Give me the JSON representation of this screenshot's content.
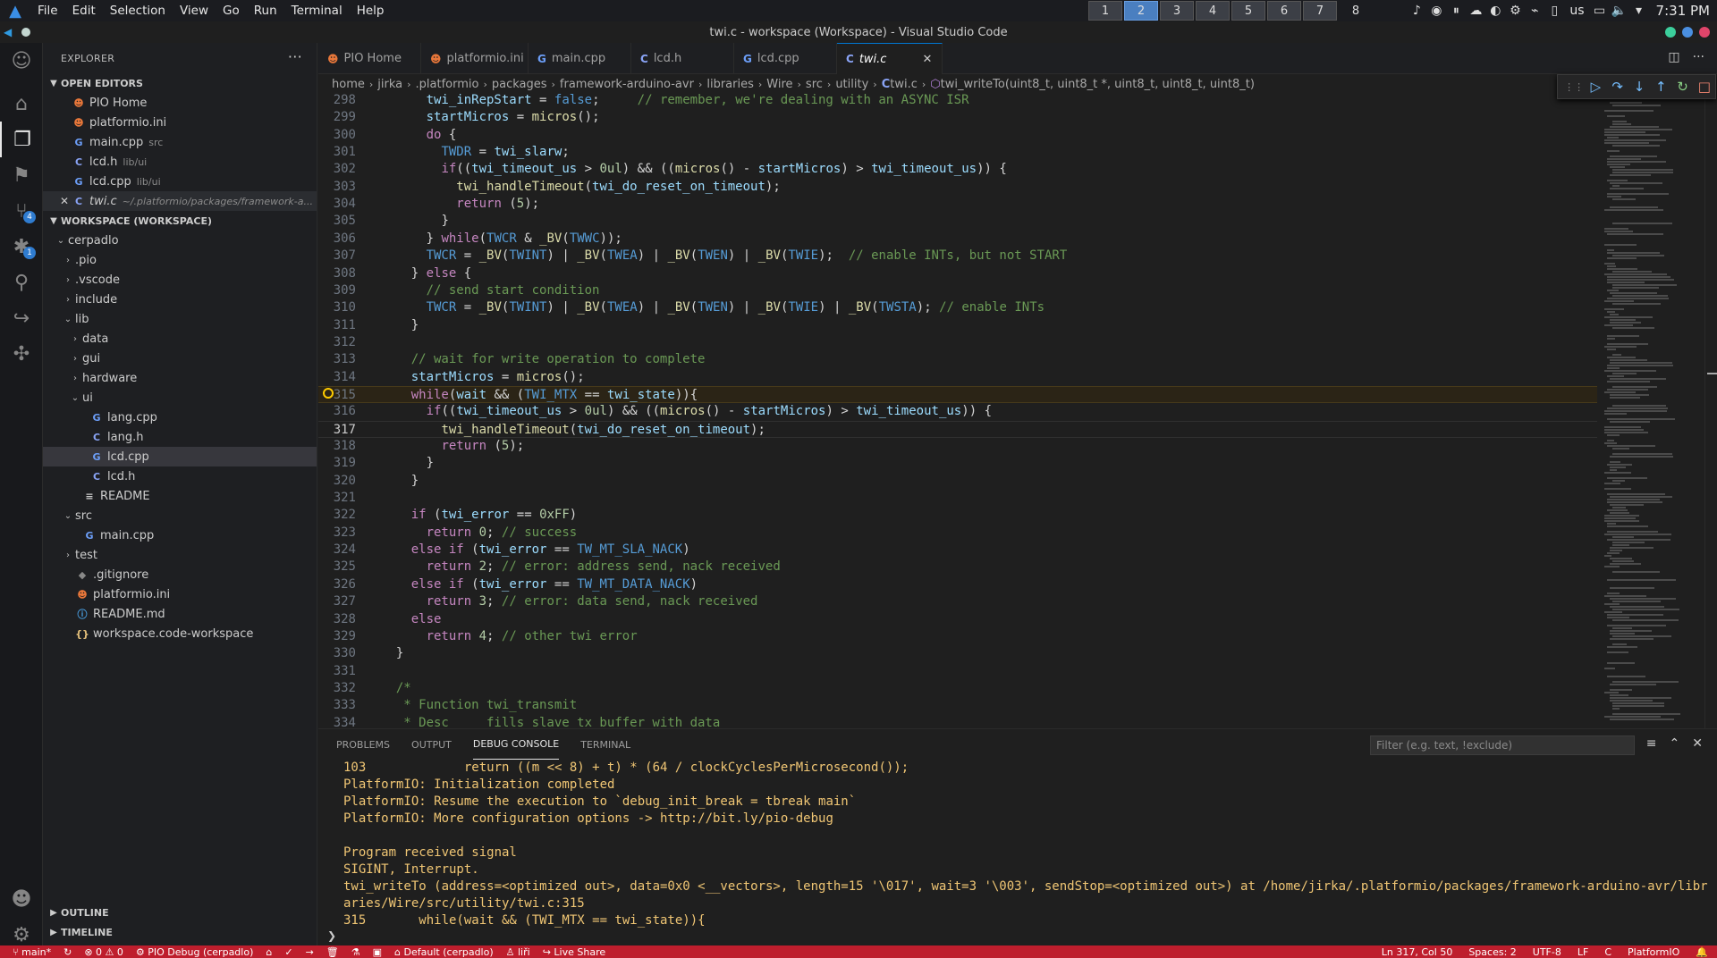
{
  "system_bar": {
    "menu": [
      "File",
      "Edit",
      "Selection",
      "View",
      "Go",
      "Run",
      "Terminal",
      "Help"
    ],
    "workspaces": [
      "1",
      "2",
      "3",
      "4",
      "5",
      "6",
      "7",
      "8"
    ],
    "active_workspace": "2",
    "keyboard_layout": "us",
    "clock": "7:31 PM"
  },
  "window": {
    "title": "twi.c - workspace (Workspace) - Visual Studio Code"
  },
  "activity_bar": {
    "scm_badge": "4",
    "debug_badge": "1"
  },
  "sidebar": {
    "header": "EXPLORER",
    "open_editors_label": "OPEN EDITORS",
    "open_editors": [
      {
        "name": "PIO Home",
        "desc": "",
        "icon": "pio"
      },
      {
        "name": "platformio.ini",
        "desc": "",
        "icon": "pio"
      },
      {
        "name": "main.cpp",
        "desc": "src",
        "icon": "cpp"
      },
      {
        "name": "lcd.h",
        "desc": "lib/ui",
        "icon": "c"
      },
      {
        "name": "lcd.cpp",
        "desc": "lib/ui",
        "icon": "cpp"
      },
      {
        "name": "twi.c",
        "desc": "~/.platformio/packages/framework-a...",
        "icon": "c"
      }
    ],
    "workspace_label": "WORKSPACE (WORKSPACE)",
    "tree": [
      {
        "name": "cerpadlo",
        "depth": 0,
        "type": "folder-open"
      },
      {
        "name": ".pio",
        "depth": 1,
        "type": "folder"
      },
      {
        "name": ".vscode",
        "depth": 1,
        "type": "folder"
      },
      {
        "name": "include",
        "depth": 1,
        "type": "folder"
      },
      {
        "name": "lib",
        "depth": 1,
        "type": "folder-open"
      },
      {
        "name": "data",
        "depth": 2,
        "type": "folder"
      },
      {
        "name": "gui",
        "depth": 2,
        "type": "folder"
      },
      {
        "name": "hardware",
        "depth": 2,
        "type": "folder"
      },
      {
        "name": "ui",
        "depth": 2,
        "type": "folder-open"
      },
      {
        "name": "lang.cpp",
        "depth": 3,
        "type": "cpp"
      },
      {
        "name": "lang.h",
        "depth": 3,
        "type": "c"
      },
      {
        "name": "lcd.cpp",
        "depth": 3,
        "type": "cpp"
      },
      {
        "name": "lcd.h",
        "depth": 3,
        "type": "c"
      },
      {
        "name": "README",
        "depth": 2,
        "type": "text"
      },
      {
        "name": "src",
        "depth": 1,
        "type": "folder-open"
      },
      {
        "name": "main.cpp",
        "depth": 2,
        "type": "cpp"
      },
      {
        "name": "test",
        "depth": 1,
        "type": "folder"
      },
      {
        "name": ".gitignore",
        "depth": 1,
        "type": "git"
      },
      {
        "name": "platformio.ini",
        "depth": 1,
        "type": "pio"
      },
      {
        "name": "README.md",
        "depth": 1,
        "type": "info"
      },
      {
        "name": "workspace.code-workspace",
        "depth": 1,
        "type": "json"
      }
    ],
    "outline_label": "OUTLINE",
    "timeline_label": "TIMELINE"
  },
  "tabs": [
    {
      "label": "PIO Home",
      "icon": "pio"
    },
    {
      "label": "platformio.ini",
      "icon": "pio"
    },
    {
      "label": "main.cpp",
      "icon": "cpp"
    },
    {
      "label": "lcd.h",
      "icon": "c"
    },
    {
      "label": "lcd.cpp",
      "icon": "cpp"
    },
    {
      "label": "twi.c",
      "icon": "c",
      "active": true
    }
  ],
  "breadcrumb": [
    "home",
    "jirka",
    ".platformio",
    "packages",
    "framework-arduino-avr",
    "libraries",
    "Wire",
    "src",
    "utility",
    "twi.c",
    "twi_writeTo(uint8_t, uint8_t *, uint8_t, uint8_t, uint8_t)"
  ],
  "editor": {
    "current_line": 317,
    "breakpoint_line": 315,
    "lines": [
      {
        "n": 298,
        "code": "      twi_inRepStart = false;     // remember, we're dealing with an ASYNC ISR"
      },
      {
        "n": 299,
        "code": "      startMicros = micros();"
      },
      {
        "n": 300,
        "code": "      do {"
      },
      {
        "n": 301,
        "code": "        TWDR = twi_slarw;"
      },
      {
        "n": 302,
        "code": "        if((twi_timeout_us > 0ul) && ((micros() - startMicros) > twi_timeout_us)) {"
      },
      {
        "n": 303,
        "code": "          twi_handleTimeout(twi_do_reset_on_timeout);"
      },
      {
        "n": 304,
        "code": "          return (5);"
      },
      {
        "n": 305,
        "code": "        }"
      },
      {
        "n": 306,
        "code": "      } while(TWCR & _BV(TWWC));"
      },
      {
        "n": 307,
        "code": "      TWCR = _BV(TWINT) | _BV(TWEA) | _BV(TWEN) | _BV(TWIE);  // enable INTs, but not START"
      },
      {
        "n": 308,
        "code": "    } else {"
      },
      {
        "n": 309,
        "code": "      // send start condition"
      },
      {
        "n": 310,
        "code": "      TWCR = _BV(TWINT) | _BV(TWEA) | _BV(TWEN) | _BV(TWIE) | _BV(TWSTA); // enable INTs"
      },
      {
        "n": 311,
        "code": "    }"
      },
      {
        "n": 312,
        "code": ""
      },
      {
        "n": 313,
        "code": "    // wait for write operation to complete"
      },
      {
        "n": 314,
        "code": "    startMicros = micros();"
      },
      {
        "n": 315,
        "code": "    while(wait && (TWI_MTX == twi_state)){"
      },
      {
        "n": 316,
        "code": "      if((twi_timeout_us > 0ul) && ((micros() - startMicros) > twi_timeout_us)) {"
      },
      {
        "n": 317,
        "code": "        twi_handleTimeout(twi_do_reset_on_timeout);"
      },
      {
        "n": 318,
        "code": "        return (5);"
      },
      {
        "n": 319,
        "code": "      }"
      },
      {
        "n": 320,
        "code": "    }"
      },
      {
        "n": 321,
        "code": ""
      },
      {
        "n": 322,
        "code": "    if (twi_error == 0xFF)"
      },
      {
        "n": 323,
        "code": "      return 0; // success"
      },
      {
        "n": 324,
        "code": "    else if (twi_error == TW_MT_SLA_NACK)"
      },
      {
        "n": 325,
        "code": "      return 2; // error: address send, nack received"
      },
      {
        "n": 326,
        "code": "    else if (twi_error == TW_MT_DATA_NACK)"
      },
      {
        "n": 327,
        "code": "      return 3; // error: data send, nack received"
      },
      {
        "n": 328,
        "code": "    else"
      },
      {
        "n": 329,
        "code": "      return 4; // other twi error"
      },
      {
        "n": 330,
        "code": "  }"
      },
      {
        "n": 331,
        "code": ""
      },
      {
        "n": 332,
        "code": "  /*"
      },
      {
        "n": 333,
        "code": "   * Function twi_transmit"
      },
      {
        "n": 334,
        "code": "   * Desc     fills slave tx buffer with data"
      }
    ]
  },
  "panel": {
    "tabs": [
      "PROBLEMS",
      "OUTPUT",
      "DEBUG CONSOLE",
      "TERMINAL"
    ],
    "active_tab": "DEBUG CONSOLE",
    "filter_placeholder": "Filter (e.g. text, !exclude)",
    "console_lines": [
      "103             return ((m << 8) + t) * (64 / clockCyclesPerMicrosecond());",
      "PlatformIO: Initialization completed",
      "PlatformIO: Resume the execution to `debug_init_break = tbreak main`",
      "PlatformIO: More configuration options -> http://bit.ly/pio-debug",
      "",
      "Program received signal",
      "SIGINT, Interrupt.",
      "twi_writeTo (address=<optimized out>, data=0x0 <__vectors>, length=15 '\\017', wait=3 '\\003', sendStop=<optimized out>) at /home/jirka/.platformio/packages/framework-arduino-avr/libr",
      "aries/Wire/src/utility/twi.c:315",
      "315       while(wait && (TWI_MTX == twi_state)){"
    ]
  },
  "status_bar": {
    "branch": "main*",
    "errors": "0",
    "warnings": "0",
    "debug_config": "PIO Debug (cerpadlo)",
    "env": "Default (cerpadlo)",
    "user": "liři",
    "live_share": "Live Share",
    "cursor": "Ln 317, Col 50",
    "spaces": "Spaces: 2",
    "encoding": "UTF-8",
    "eol": "LF",
    "language": "C",
    "platform": "PlatformIO"
  },
  "colors": {
    "status_bar": "#be1e2d",
    "accent": "#0078d4",
    "console_text": "#f0c674"
  }
}
